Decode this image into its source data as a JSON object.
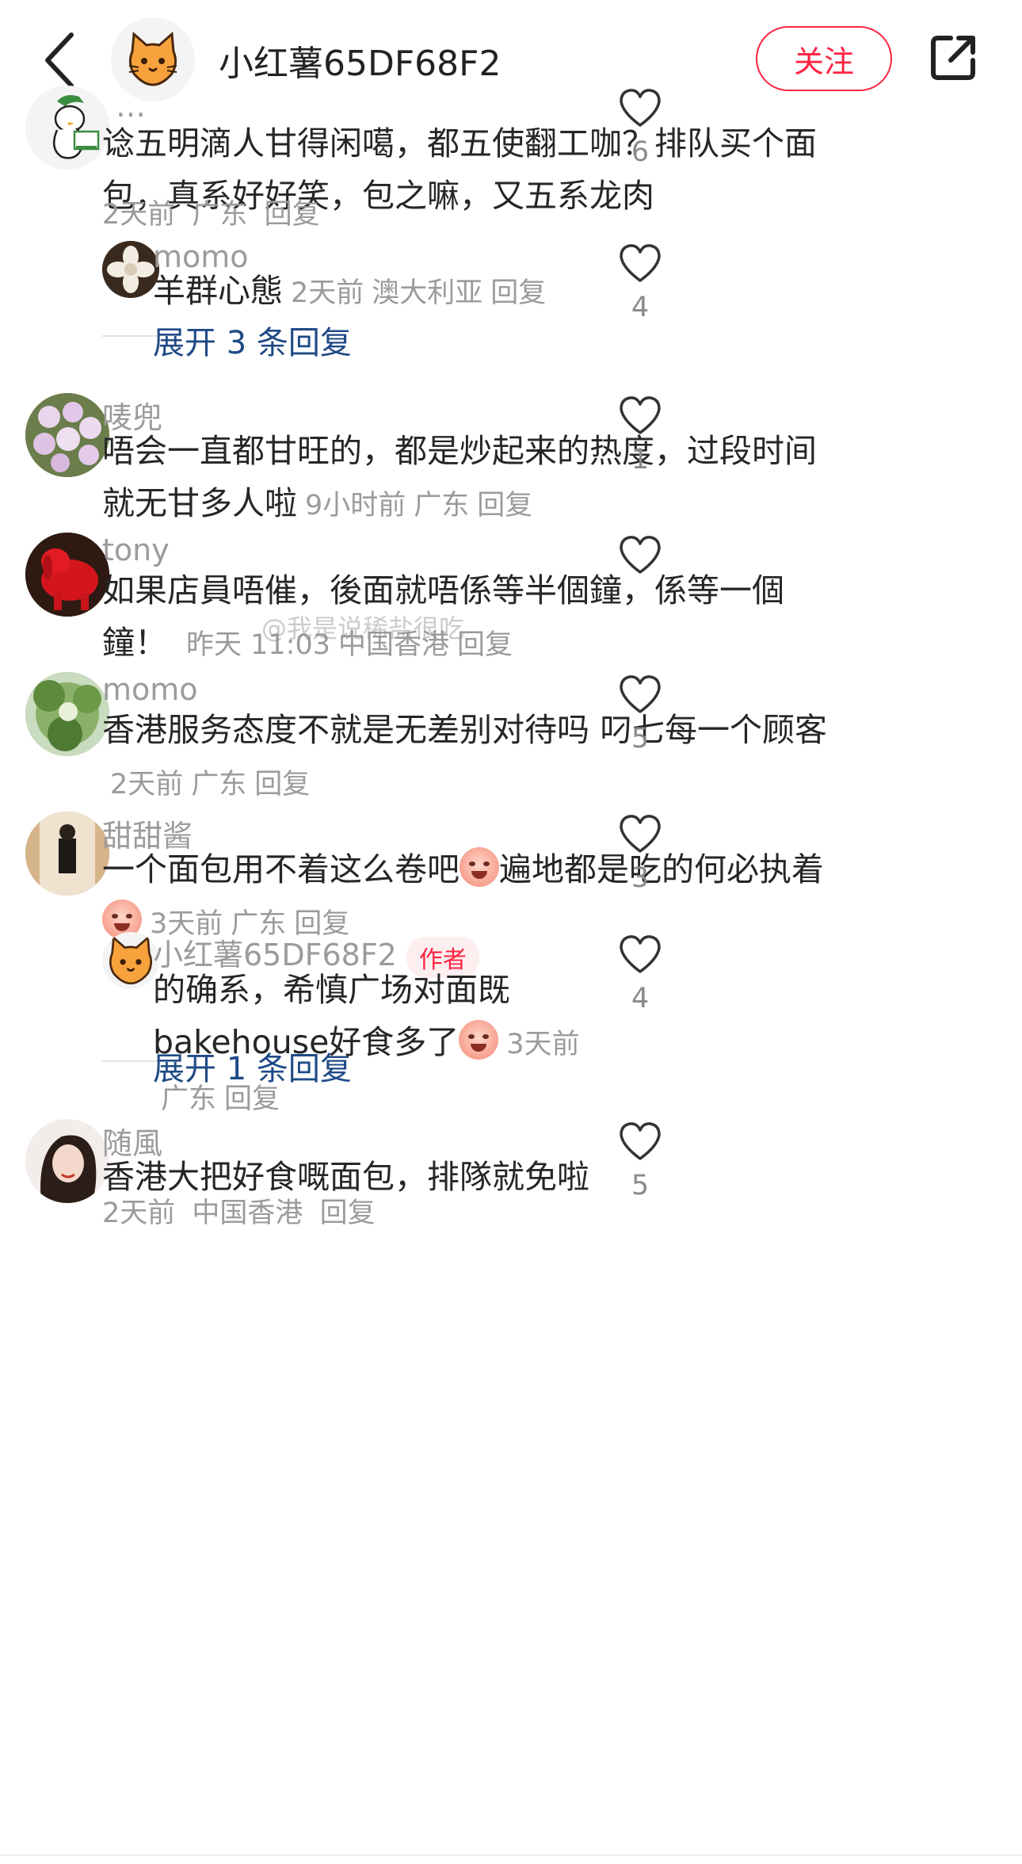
{
  "header": {
    "title": "小红薯65DF68F2",
    "follow_label": "关注",
    "back_icon": "chevron-left-icon",
    "share_icon": "share-icon",
    "avatar_icon": "cat-avatar"
  },
  "comments": [
    {
      "username": "…",
      "text": "谂五明滴人甘得闲噶，都五使翻工咖？排队买个面包，真系好好笑，包之嘛，又五系龙肉",
      "time": "2天前",
      "location": "广东",
      "reply_label": "回复",
      "likes": "6",
      "replies": [
        {
          "username": "momo",
          "text": "羊群心態",
          "time": "2天前",
          "location": "澳大利亚",
          "reply_label": "回复",
          "likes": "4"
        }
      ],
      "expand_label": "展开 3 条回复"
    },
    {
      "username": "唛兜",
      "text": "唔会一直都甘旺的，都是炒起来的热度，过段时间就无甘多人啦",
      "time": "9小时前",
      "location": "广东",
      "reply_label": "回复",
      "likes": "1"
    },
    {
      "username": "tony",
      "text": "如果店員唔催，後面就唔係等半個鐘，係等一個鐘！",
      "time": "昨天 11:03",
      "location": "中国香港",
      "reply_label": "回复",
      "likes": ""
    },
    {
      "username": "momo",
      "text": "香港服务态度不就是无差别对待吗 叼七每一个顾客",
      "time": "2天前",
      "location": "广东",
      "reply_label": "回复",
      "likes": "5"
    },
    {
      "username": "甜甜酱",
      "text_a": "一个面包用不着这么卷吧",
      "text_b": "遍地都是吃的何必执着",
      "time": "3天前",
      "location": "广东",
      "reply_label": "回复",
      "likes": "3",
      "replies": [
        {
          "username": "小红薯65DF68F2",
          "badge": "作者",
          "text": "的确系，希慎广场对面既bakehouse好食多了",
          "time": "3天前",
          "location": "广东",
          "reply_label": "回复",
          "likes": "4"
        }
      ],
      "expand_label": "展开 1 条回复"
    },
    {
      "username": "随風",
      "text": "香港大把好食嘅面包，排隊就免啦",
      "time": "2天前",
      "location": "中国香港",
      "reply_label": "回复",
      "likes": "5"
    }
  ],
  "watermark": "@我是说稀盐很吃",
  "icons": {
    "like": "heart-outline-icon"
  },
  "colors": {
    "accent": "#ff2442",
    "link": "#1f4a86",
    "meta": "#9b9b9b",
    "text": "#262626"
  }
}
